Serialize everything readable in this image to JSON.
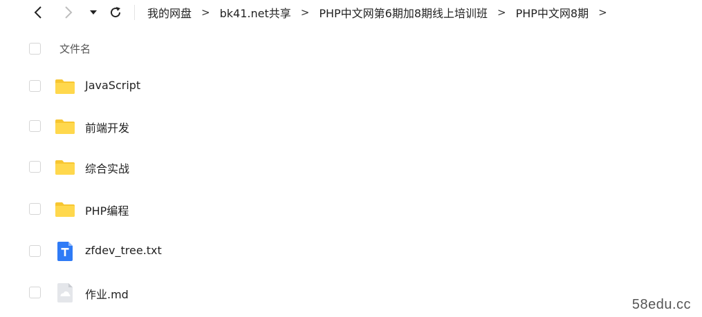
{
  "toolbar": {
    "back_icon": "chevron-left-icon",
    "forward_icon": "chevron-right-icon",
    "dropdown_icon": "caret-down-icon",
    "refresh_icon": "refresh-icon"
  },
  "breadcrumb": [
    {
      "label": "我的网盘"
    },
    {
      "label": "bk41.net共享"
    },
    {
      "label": "PHP中文网第6期加8期线上培训班"
    },
    {
      "label": "PHP中文网8期"
    }
  ],
  "breadcrumb_separator": ">",
  "list": {
    "header": {
      "name_label": "文件名"
    },
    "items": [
      {
        "name": "JavaScript",
        "type": "folder",
        "icon": "folder-icon"
      },
      {
        "name": "前端开发",
        "type": "folder",
        "icon": "folder-icon"
      },
      {
        "name": "综合实战",
        "type": "folder",
        "icon": "folder-icon"
      },
      {
        "name": "PHP编程",
        "type": "folder",
        "icon": "folder-icon"
      },
      {
        "name": "zfdev_tree.txt",
        "type": "txt",
        "icon": "text-file-icon"
      },
      {
        "name": "作业.md",
        "type": "md",
        "icon": "generic-file-icon"
      }
    ]
  },
  "colors": {
    "folder": "#FFD84D",
    "folder_dark": "#F7C631",
    "txt_icon": "#2F7BF6",
    "generic_icon": "#E4E6EA"
  },
  "watermark": "58edu.cc"
}
